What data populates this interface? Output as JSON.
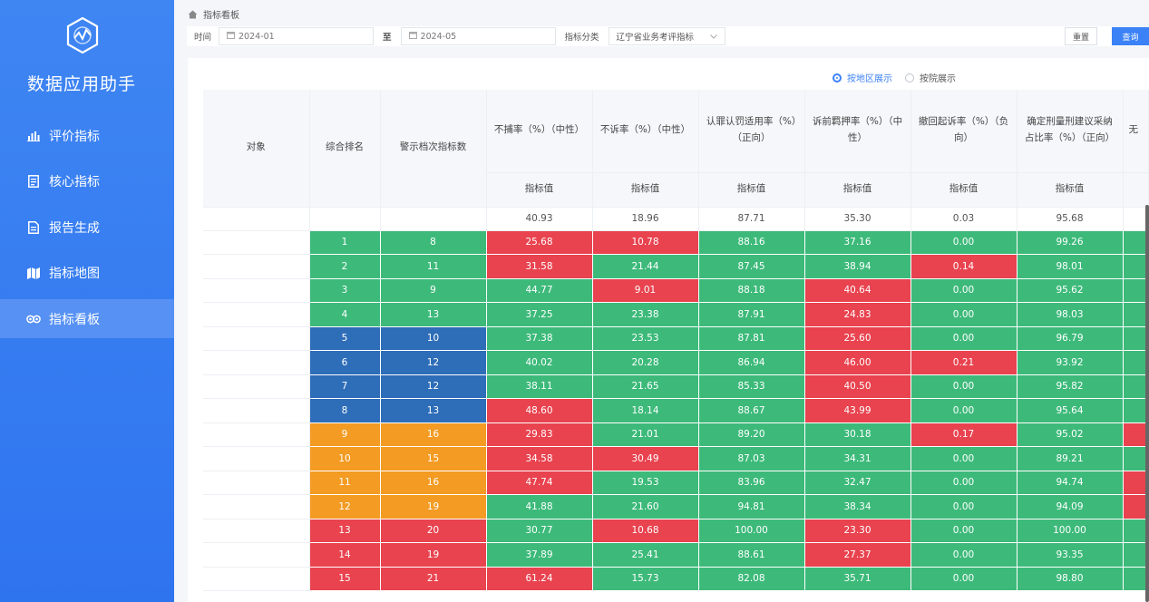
{
  "app": {
    "title": "数据应用助手"
  },
  "sidebar": {
    "items": [
      {
        "label": "评价指标",
        "icon": "bar-chart-icon",
        "active": false
      },
      {
        "label": "核心指标",
        "icon": "document-icon",
        "active": false
      },
      {
        "label": "报告生成",
        "icon": "report-icon",
        "active": false
      },
      {
        "label": "指标地图",
        "icon": "map-icon",
        "active": false
      },
      {
        "label": "指标看板",
        "icon": "eye-icon",
        "active": true
      }
    ]
  },
  "breadcrumb": {
    "label": "指标看板"
  },
  "filters": {
    "time_label": "时间",
    "start_date": "2024-01",
    "to_label": "至",
    "end_date": "2024-05",
    "category_label": "指标分类",
    "category_value": "辽宁省业务考评指标",
    "reset_label": "重置",
    "query_label": "查询"
  },
  "view_mode": {
    "options": [
      "按地区展示",
      "按院展示"
    ],
    "selected": "按地区展示"
  },
  "table": {
    "columns": [
      "对象",
      "综合排名",
      "警示档次指标数",
      "不捕率（%）（中性）",
      "不诉率（%）（中性）",
      "认罪认罚适用率（%）（正向）",
      "诉前羁押率（%）（中性）",
      "撤回起诉率（%）（负向）",
      "确定刑量刑建议采纳占比率（%）（正向）",
      "无"
    ],
    "subheader": "指标值",
    "average_row": [
      "40.93",
      "18.96",
      "87.71",
      "35.30",
      "0.03",
      "95.68"
    ],
    "colors": {
      "green": "#3dba7a",
      "red": "#e8434f",
      "blue": "#2e6db8",
      "orange": "#f39b22"
    },
    "rows": [
      {
        "rank": "1",
        "warn": "8",
        "tier": "green",
        "vals": [
          "25.68",
          "10.78",
          "88.16",
          "37.16",
          "0.00",
          "99.26"
        ],
        "c": [
          "r",
          "r",
          "g",
          "g",
          "g",
          "g",
          "g"
        ]
      },
      {
        "rank": "2",
        "warn": "11",
        "tier": "green",
        "vals": [
          "31.58",
          "21.44",
          "87.45",
          "38.94",
          "0.14",
          "98.01"
        ],
        "c": [
          "r",
          "g",
          "g",
          "g",
          "r",
          "g",
          "g"
        ]
      },
      {
        "rank": "3",
        "warn": "9",
        "tier": "green",
        "vals": [
          "44.77",
          "9.01",
          "88.18",
          "40.64",
          "0.00",
          "95.62"
        ],
        "c": [
          "g",
          "r",
          "g",
          "r",
          "g",
          "g",
          "g"
        ]
      },
      {
        "rank": "4",
        "warn": "13",
        "tier": "green",
        "vals": [
          "37.25",
          "23.38",
          "87.91",
          "24.83",
          "0.00",
          "98.03"
        ],
        "c": [
          "g",
          "g",
          "g",
          "r",
          "g",
          "g",
          "g"
        ]
      },
      {
        "rank": "5",
        "warn": "10",
        "tier": "blue",
        "vals": [
          "37.38",
          "23.53",
          "87.81",
          "25.60",
          "0.00",
          "96.79"
        ],
        "c": [
          "g",
          "g",
          "g",
          "r",
          "g",
          "g",
          "g"
        ]
      },
      {
        "rank": "6",
        "warn": "12",
        "tier": "blue",
        "vals": [
          "40.02",
          "20.28",
          "86.94",
          "46.00",
          "0.21",
          "93.92"
        ],
        "c": [
          "g",
          "g",
          "g",
          "r",
          "r",
          "g",
          "g"
        ]
      },
      {
        "rank": "7",
        "warn": "12",
        "tier": "blue",
        "vals": [
          "38.11",
          "21.65",
          "85.33",
          "40.50",
          "0.00",
          "95.82"
        ],
        "c": [
          "g",
          "g",
          "g",
          "r",
          "g",
          "g",
          "g"
        ]
      },
      {
        "rank": "8",
        "warn": "13",
        "tier": "blue",
        "vals": [
          "48.60",
          "18.14",
          "88.67",
          "43.99",
          "0.00",
          "95.64"
        ],
        "c": [
          "r",
          "g",
          "g",
          "r",
          "g",
          "g",
          "g"
        ]
      },
      {
        "rank": "9",
        "warn": "16",
        "tier": "orange",
        "vals": [
          "29.83",
          "21.01",
          "89.20",
          "30.18",
          "0.17",
          "95.02"
        ],
        "c": [
          "r",
          "g",
          "g",
          "g",
          "r",
          "g",
          "r"
        ]
      },
      {
        "rank": "10",
        "warn": "15",
        "tier": "orange",
        "vals": [
          "34.58",
          "30.49",
          "87.03",
          "34.31",
          "0.00",
          "89.21"
        ],
        "c": [
          "r",
          "r",
          "g",
          "g",
          "g",
          "g",
          "g"
        ]
      },
      {
        "rank": "11",
        "warn": "16",
        "tier": "orange",
        "vals": [
          "47.74",
          "19.53",
          "83.96",
          "32.47",
          "0.00",
          "94.74"
        ],
        "c": [
          "r",
          "g",
          "g",
          "g",
          "g",
          "g",
          "r"
        ]
      },
      {
        "rank": "12",
        "warn": "19",
        "tier": "orange",
        "vals": [
          "41.88",
          "21.60",
          "94.81",
          "38.34",
          "0.00",
          "94.09"
        ],
        "c": [
          "g",
          "g",
          "g",
          "g",
          "g",
          "g",
          "r"
        ]
      },
      {
        "rank": "13",
        "warn": "20",
        "tier": "red",
        "vals": [
          "30.77",
          "10.68",
          "100.00",
          "23.30",
          "0.00",
          "100.00"
        ],
        "c": [
          "g",
          "r",
          "g",
          "r",
          "g",
          "g",
          "g"
        ]
      },
      {
        "rank": "14",
        "warn": "19",
        "tier": "red",
        "vals": [
          "37.89",
          "25.41",
          "88.61",
          "27.37",
          "0.00",
          "93.35"
        ],
        "c": [
          "g",
          "g",
          "g",
          "r",
          "g",
          "g",
          "g"
        ]
      },
      {
        "rank": "15",
        "warn": "21",
        "tier": "red",
        "vals": [
          "61.24",
          "15.73",
          "82.08",
          "35.71",
          "0.00",
          "98.80"
        ],
        "c": [
          "r",
          "g",
          "g",
          "g",
          "g",
          "g",
          "g"
        ]
      }
    ]
  }
}
